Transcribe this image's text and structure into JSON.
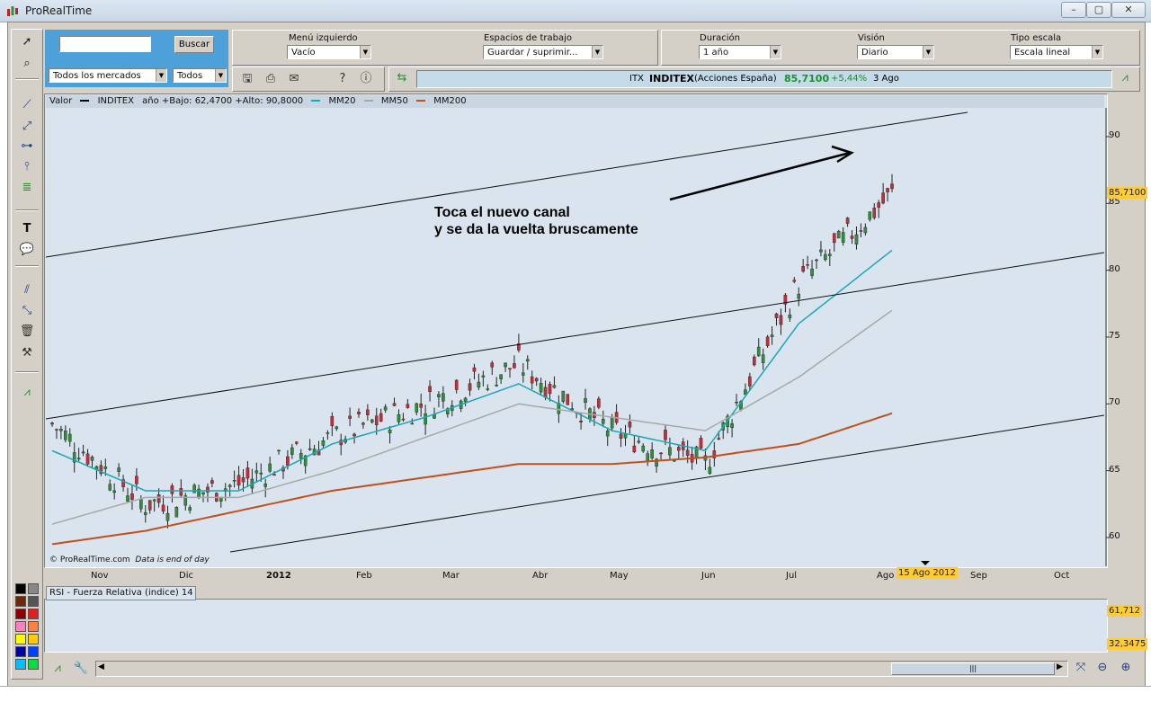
{
  "window": {
    "title": "ProRealTime",
    "controls": [
      "–",
      "▢",
      "✕"
    ]
  },
  "search": {
    "value": "",
    "button": "Buscar",
    "market": "Todos los mercados",
    "filter": "Todos"
  },
  "settings": [
    {
      "label": "Menú izquierdo",
      "value": "Vacío"
    },
    {
      "label": "Espacios de trabajo",
      "value": "Guardar / suprimir..."
    },
    {
      "label": "Duración",
      "value": "1 año"
    },
    {
      "label": "Visión",
      "value": "Diario"
    },
    {
      "label": "Tipo escala",
      "value": "Escala lineal"
    }
  ],
  "ticker": {
    "code": "ITX",
    "name": "INDITEX",
    "market": "(Acciones España)",
    "price": "85,7100",
    "change": "+5,44%",
    "date": "3 Ago"
  },
  "legend": {
    "valor": "Valor",
    "instrument": "INDITEX",
    "range": "año +Bajo: 62,4700 +Alto: 90,8000",
    "mm20": "MM20",
    "mm50": "MM50",
    "mm200": "MM200"
  },
  "colors": {
    "mm20": "#1aa6b7",
    "mm50": "#a8a8a8",
    "mm200": "#c0501e",
    "rsi": "#2233aa",
    "bull": "#2f8f3a",
    "bear": "#c0303a",
    "price_box": "#ffcc33"
  },
  "annotation": {
    "line1": "Toca el nuevo canal",
    "line2": "y se da la vuelta bruscamente"
  },
  "copyright": "© ProRealTime.com",
  "eod_note": "Data is end of day",
  "current_date_label": "15 Ago 2012",
  "current_price_label": "85,7100",
  "rsi": {
    "title": "RSI - Fuerza Relativa (indice) 14",
    "value_high": "61,712",
    "value_low": "32,3475"
  },
  "chart_data": {
    "type": "candlestick",
    "title": "",
    "x": [
      "Nov",
      "Dic",
      "2012",
      "Feb",
      "Mar",
      "Abr",
      "May",
      "Jun",
      "Jul",
      "Ago",
      "Sep",
      "Oct"
    ],
    "y_ticks": [
      "90",
      "85",
      "80",
      "75",
      "70",
      "65",
      "60"
    ],
    "ylim": [
      58.5,
      92
    ],
    "grid": false,
    "series": [
      {
        "name": "INDITEX",
        "monthly_close": [
          68.5,
          62.5,
          64.0,
          67.5,
          70.0,
          73.0,
          68.0,
          65.5,
          79.0,
          85.71
        ]
      },
      {
        "name": "MM20",
        "monthly": [
          66.5,
          63.5,
          63.5,
          67.0,
          69.0,
          71.5,
          68.0,
          66.5,
          76.0,
          81.5
        ]
      },
      {
        "name": "MM50",
        "monthly": [
          61.0,
          63.0,
          63.0,
          65.0,
          67.5,
          70.0,
          69.0,
          68.0,
          72.0,
          77.0
        ]
      },
      {
        "name": "MM200",
        "monthly": [
          59.5,
          60.5,
          62.0,
          63.5,
          64.5,
          65.5,
          65.5,
          66.0,
          67.0,
          69.3
        ]
      }
    ],
    "summary": {
      "low": 62.47,
      "high": 90.8,
      "last": 85.71
    }
  }
}
